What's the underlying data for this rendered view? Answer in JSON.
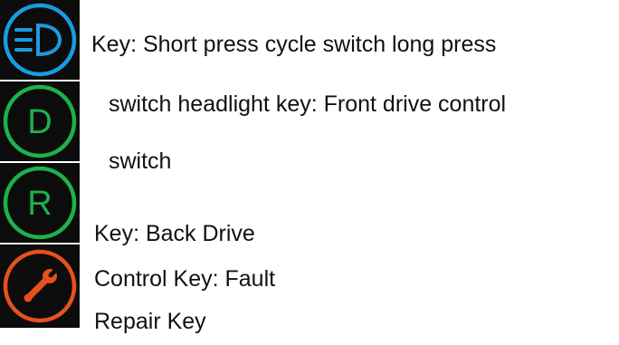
{
  "icons": {
    "headlight": {
      "name": "headlight-icon",
      "ring_color": "#1a9be0",
      "glyph_color": "#1a9be0"
    },
    "drive": {
      "name": "drive-icon",
      "letter": "D",
      "ring_color": "#1cb24a",
      "glyph_color": "#1cb24a"
    },
    "reverse": {
      "name": "reverse-icon",
      "letter": "R",
      "ring_color": "#1cb24a",
      "glyph_color": "#1cb24a"
    },
    "fault": {
      "name": "wrench-icon",
      "ring_color": "#e8501f",
      "glyph_color": "#e8501f"
    }
  },
  "text_lines": [
    "Key: Short press cycle switch long press",
    "switch headlight key: Front drive control",
    "switch",
    "Key: Back Drive",
    "Control Key: Fault",
    "Repair Key"
  ]
}
